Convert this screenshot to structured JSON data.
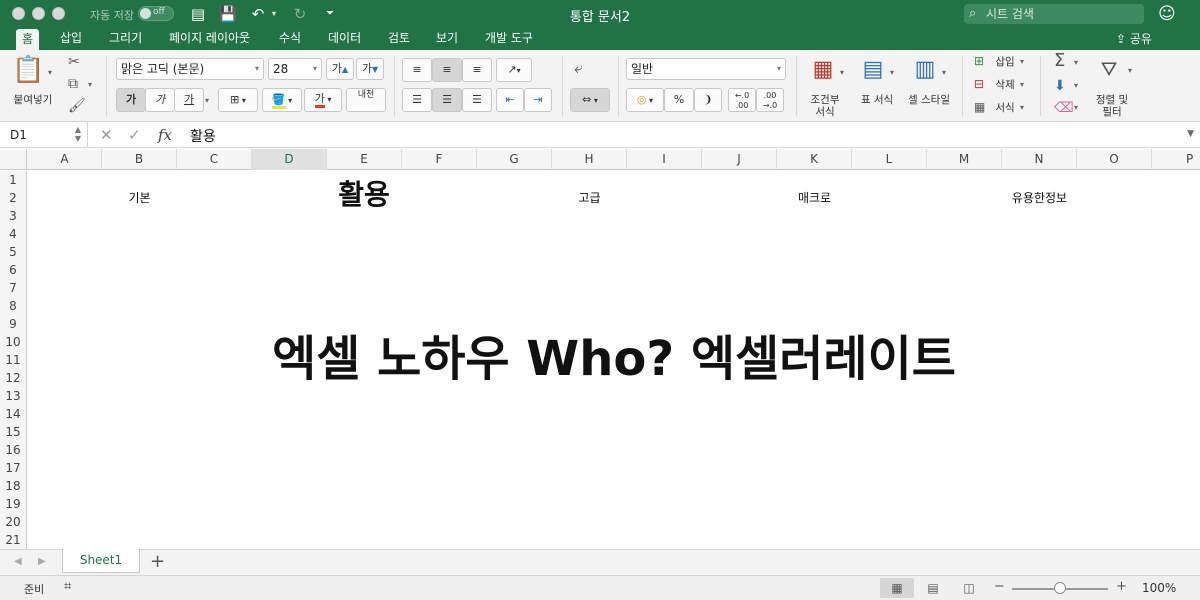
{
  "window": {
    "title": "통합 문서2",
    "autosave_label": "자동 저장",
    "autosave_state": "off"
  },
  "search": {
    "placeholder": "시트 검색"
  },
  "tabs": [
    {
      "label": "홈",
      "active": true
    },
    {
      "label": "삽입"
    },
    {
      "label": "그리기"
    },
    {
      "label": "페이지 레이아웃"
    },
    {
      "label": "수식"
    },
    {
      "label": "데이터"
    },
    {
      "label": "검토"
    },
    {
      "label": "보기"
    },
    {
      "label": "개발 도구"
    }
  ],
  "share_label": "공유",
  "ribbon": {
    "paste_label": "붙여넣기",
    "font_name": "맑은 고딕 (본문)",
    "font_size": "28",
    "grow_font": "가",
    "shrink_font": "가",
    "bold": "가",
    "italic": "가",
    "underline": "가",
    "font_color_glyph": "가",
    "phonetic_glyph": "내천",
    "number_format": "일반",
    "percent": "%",
    "comma": "❩",
    "conditional_format": "조건부\n서식",
    "conditional_format_l1": "조건부",
    "conditional_format_l2": "서식",
    "table_format": "표 서식",
    "cell_style": "셀 스타일",
    "insert": "삽입",
    "delete": "삭제",
    "format": "서식",
    "sort_filter_l1": "정렬 및",
    "sort_filter_l2": "필터"
  },
  "formula_bar": {
    "name_box": "D1",
    "content": "활용"
  },
  "columns": [
    "A",
    "B",
    "C",
    "D",
    "E",
    "F",
    "G",
    "H",
    "I",
    "J",
    "K",
    "L",
    "M",
    "N",
    "O",
    "P"
  ],
  "selected_column": "D",
  "rows": [
    "1",
    "2",
    "3",
    "4",
    "5",
    "6",
    "7",
    "8",
    "9",
    "10",
    "11",
    "12",
    "13",
    "14",
    "15",
    "16",
    "17",
    "18",
    "19",
    "20",
    "21"
  ],
  "cells": {
    "b2": "기본",
    "d2": "활용",
    "h2": "고급",
    "k2": "매크로",
    "n2": "유용한정보",
    "headline": "엑셀 노하우 Who? 엑셀러레이트"
  },
  "sheet_tab": "Sheet1",
  "status": {
    "ready": "준비",
    "zoom": "100%"
  },
  "colors": {
    "excel_green": "#217346",
    "ribbon_bg": "#f3f3f3"
  }
}
